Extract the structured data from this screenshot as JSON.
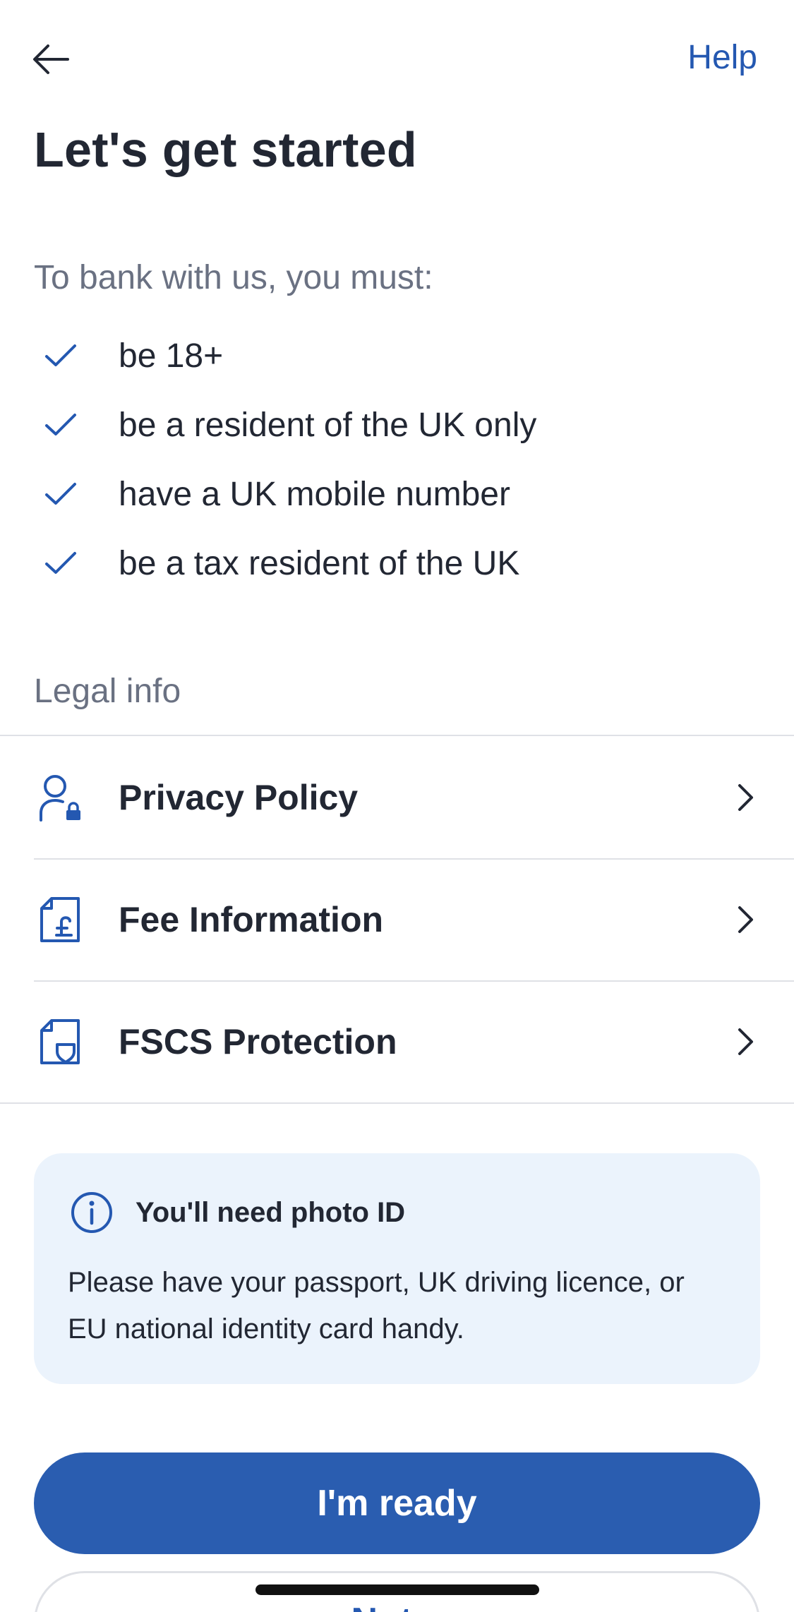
{
  "header": {
    "back_icon": "arrow-left-icon",
    "help_label": "Help"
  },
  "page_title": "Let's get started",
  "requirements": {
    "intro": "To bank with us, you must:",
    "items": [
      {
        "label": "be 18+",
        "icon": "check-icon"
      },
      {
        "label": "be a resident of the UK only",
        "icon": "check-icon"
      },
      {
        "label": "have a UK mobile number",
        "icon": "check-icon"
      },
      {
        "label": "be a tax resident of the UK",
        "icon": "check-icon"
      }
    ]
  },
  "legal": {
    "heading": "Legal info",
    "items": [
      {
        "label": "Privacy Policy",
        "icon": "person-lock-icon"
      },
      {
        "label": "Fee Information",
        "icon": "document-pound-icon"
      },
      {
        "label": "FSCS Protection",
        "icon": "document-shield-icon"
      }
    ]
  },
  "info_card": {
    "icon": "info-icon",
    "title": "You'll need photo ID",
    "body": "Please have your passport, UK driving licence, or EU national identity card handy."
  },
  "actions": {
    "primary_label": "I'm ready",
    "secondary_label": "Not..."
  },
  "colors": {
    "accent": "#2a5db0",
    "link": "#2458b1",
    "text": "#222733",
    "muted": "#6a7182",
    "card_bg": "#ebf3fc",
    "divider": "#dfe1e6"
  }
}
